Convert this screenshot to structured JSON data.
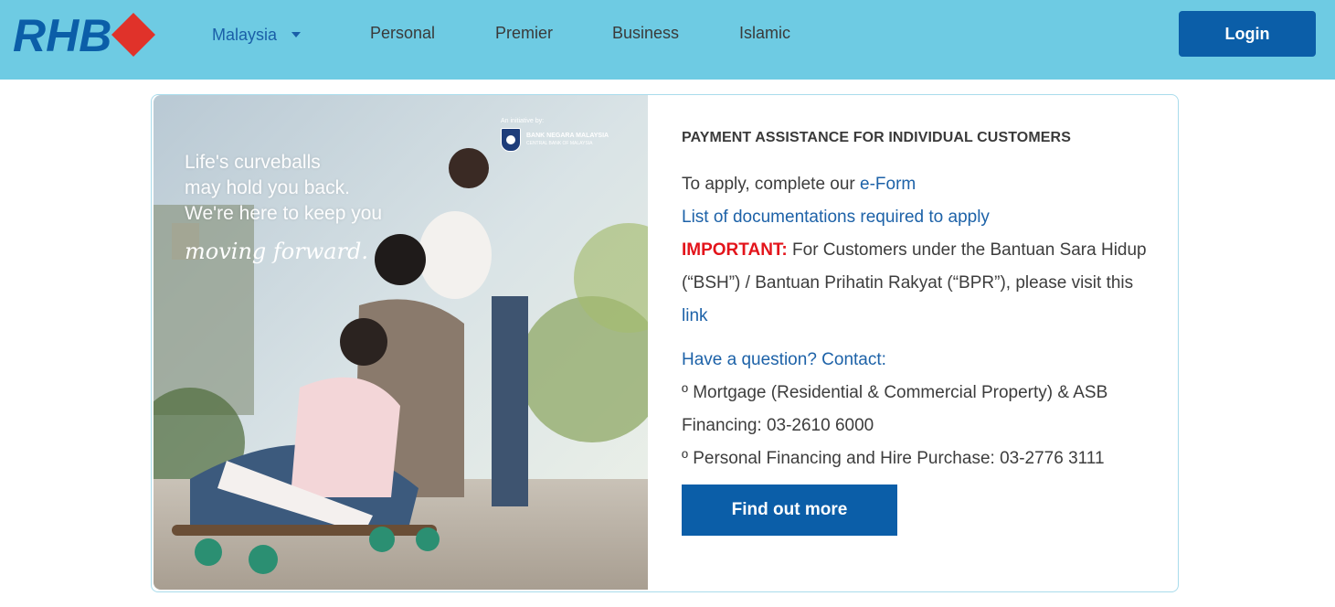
{
  "header": {
    "logo_text": "RHB",
    "region": "Malaysia",
    "nav": [
      "Personal",
      "Premier",
      "Business",
      "Islamic"
    ],
    "login_label": "Login"
  },
  "promo": {
    "initiative": "An initiative by:",
    "bnm_name": "BANK NEGARA MALAYSIA",
    "bnm_sub": "CENTRAL BANK OF MALAYSIA",
    "lines": [
      "Life's curveballs",
      "may hold you back.",
      "We're here to keep you"
    ],
    "script": "moving forward."
  },
  "content": {
    "heading": "PAYMENT ASSISTANCE FOR INDIVIDUAL CUSTOMERS",
    "apply_prefix": "To apply, complete our ",
    "eform_link": "e-Form",
    "docs_link": "List of documentations required to apply",
    "important_label": "IMPORTANT:",
    "important_text": " For Customers under the Bantuan Sara Hidup (“BSH”) / Bantuan Prihatin Rakyat (“BPR”), please visit this ",
    "important_link": "link",
    "contact_heading": "Have a question? Contact:",
    "contact_mortgage": "º Mortgage (Residential & Commercial Property) & ASB Financing: 03-2610 6000",
    "contact_personal": "º Personal Financing and Hire Purchase: 03-2776 3111",
    "cta_label": "Find out more"
  },
  "colors": {
    "header_bg": "#6ecbe3",
    "brand_blue": "#0b5ea8",
    "logo_red": "#e0322a",
    "link_blue": "#1d62a8",
    "important_red": "#e3141b"
  }
}
